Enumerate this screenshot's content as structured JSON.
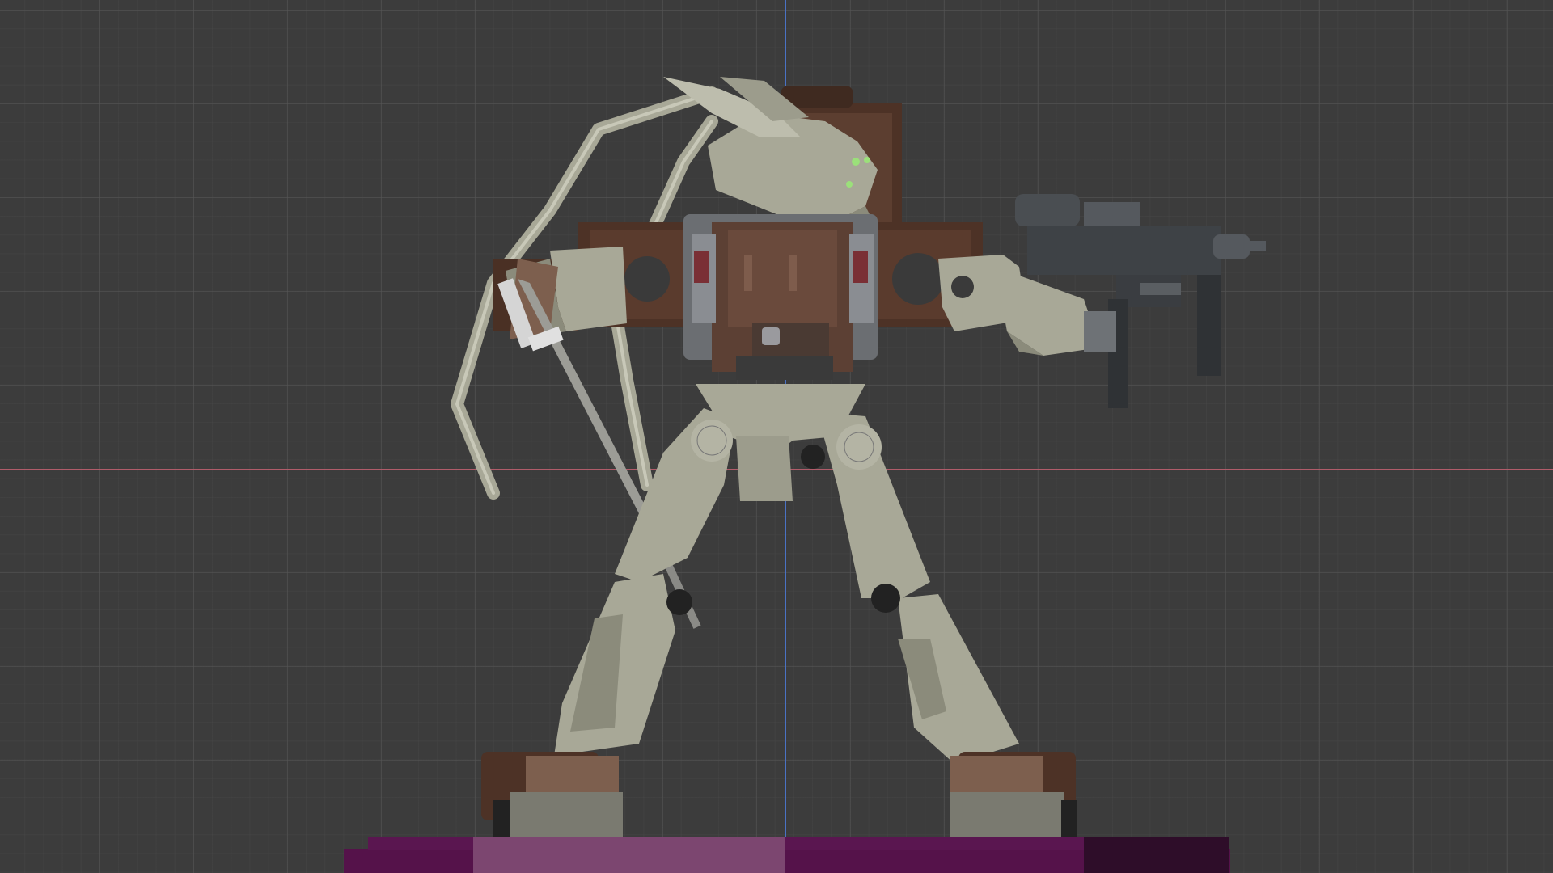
{
  "viewport": {
    "background_color": "#3c3c3c",
    "grid_color": "#555555",
    "axis_x_color": "#b05c6a",
    "axis_z_color": "#4a72c4"
  },
  "scene": {
    "object": "mech-robot",
    "colors": {
      "armor_light": "#a8a897",
      "armor_shade": "#8b8b7b",
      "armor_brown": "#4d3226",
      "metal_dark": "#4a4e52",
      "joint_black": "#222222",
      "eye_green": "#9be07a",
      "ground_magenta": "#55124a",
      "ground_pink": "#7c4670"
    }
  }
}
